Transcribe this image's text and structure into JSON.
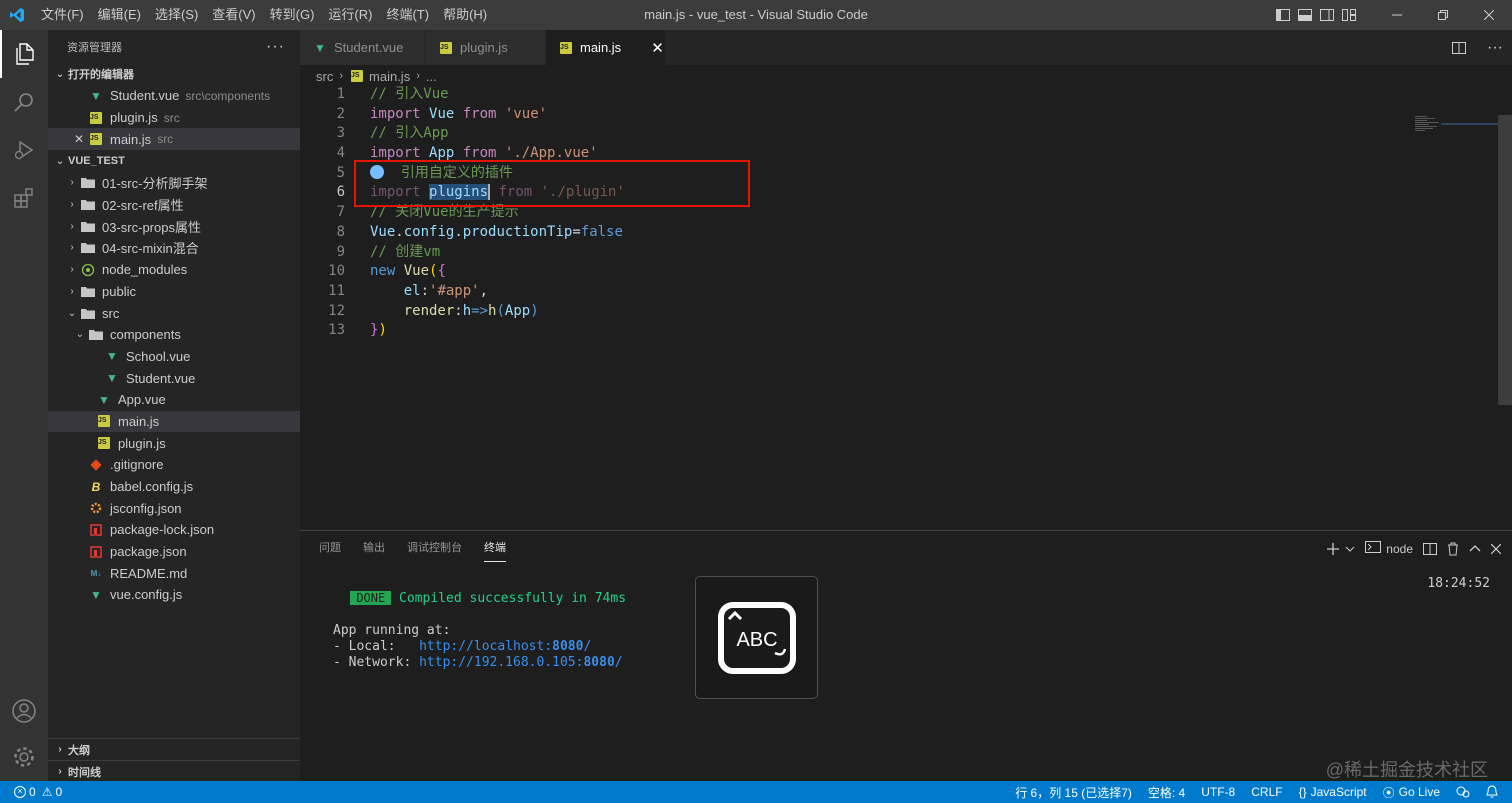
{
  "titlebar": {
    "menus": [
      "文件(F)",
      "编辑(E)",
      "选择(S)",
      "查看(V)",
      "转到(G)",
      "运行(R)",
      "终端(T)",
      "帮助(H)"
    ],
    "title": "main.js - vue_test - Visual Studio Code"
  },
  "activity": [
    "explorer-icon",
    "search-icon",
    "run-debug-icon",
    "extensions-icon",
    "account-icon",
    "settings-gear-icon"
  ],
  "sidebar": {
    "header": "资源管理器",
    "open_editors_title": "打开的编辑器",
    "open_editors": [
      {
        "name": "Student.vue",
        "desc": "src\\components",
        "icon": "vue"
      },
      {
        "name": "plugin.js",
        "desc": "src",
        "icon": "js"
      },
      {
        "name": "main.js",
        "desc": "src",
        "icon": "js"
      }
    ],
    "project_title": "VUE_TEST",
    "tree": [
      {
        "name": "01-src-分析脚手架",
        "icon": "folder"
      },
      {
        "name": "02-src-ref属性",
        "icon": "folder"
      },
      {
        "name": "03-src-props属性",
        "icon": "folder"
      },
      {
        "name": "04-src-mixin混合",
        "icon": "folder"
      },
      {
        "name": "node_modules",
        "icon": "folder"
      },
      {
        "name": "public",
        "icon": "folder"
      },
      {
        "name": "src",
        "icon": "folder"
      },
      {
        "name": "components",
        "icon": "folder"
      },
      {
        "name": "School.vue",
        "icon": "vue"
      },
      {
        "name": "Student.vue",
        "icon": "vue"
      },
      {
        "name": "App.vue",
        "icon": "vue"
      },
      {
        "name": "main.js",
        "icon": "js"
      },
      {
        "name": "plugin.js",
        "icon": "js"
      },
      {
        "name": ".gitignore",
        "icon": "git"
      },
      {
        "name": "babel.config.js",
        "icon": "babel"
      },
      {
        "name": "jsconfig.json",
        "icon": "json"
      },
      {
        "name": "package-lock.json",
        "icon": "npm"
      },
      {
        "name": "package.json",
        "icon": "npm"
      },
      {
        "name": "README.md",
        "icon": "md"
      },
      {
        "name": "vue.config.js",
        "icon": "vue"
      }
    ],
    "outline_title": "大纲",
    "timeline_title": "时间线"
  },
  "editor": {
    "tabs": [
      "Student.vue",
      "plugin.js",
      "main.js"
    ],
    "close_glyph": "✕",
    "breadcrumb": [
      "src",
      "main.js",
      "..."
    ],
    "line_numbers": [
      "1",
      "2",
      "3",
      "4",
      "5",
      "6",
      "7",
      "8",
      "9",
      "10",
      "11",
      "12",
      "13"
    ],
    "current_line": "6"
  },
  "panel": {
    "tabs": [
      "问题",
      "输出",
      "调试控制台",
      "终端"
    ],
    "terminal_name": "node",
    "done_label": "DONE",
    "compiled_msg": "Compiled successfully in 74ms",
    "time": "18:24:52",
    "running_at": "App running at:",
    "local_label": "- Local:   ",
    "local_url": "http://localhost:",
    "local_port": "8080",
    "network_label": "- Network: ",
    "network_url": "http://192.168.0.105:",
    "network_port": "8080",
    "slash": "/",
    "overlay_text": "ABC"
  },
  "statusbar": {
    "errors": "0",
    "warnings": "0",
    "position": "行 6，列 15 (已选择7)",
    "spaces": "空格: 4",
    "encoding": "UTF-8",
    "eol": "CRLF",
    "language": "JavaScript",
    "golive": "Go Live"
  },
  "watermark": "@稀土掘金技术社区",
  "colors": {
    "accent": "#007acc",
    "highlight_box": "#e51400",
    "done": "#23a753"
  }
}
